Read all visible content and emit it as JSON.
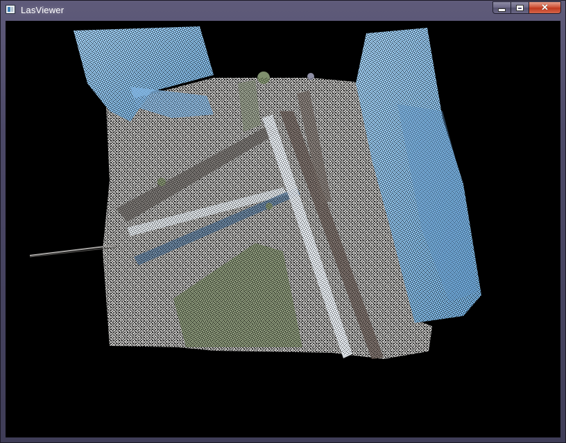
{
  "window": {
    "title": "LasViewer",
    "icon": "app-icon",
    "controls": {
      "minimize_icon": "minimize-icon",
      "maximize_icon": "maximize-icon",
      "close_icon": "close-icon",
      "close_glyph": "✕"
    }
  },
  "viewport": {
    "background": "#000000",
    "content": "point-cloud"
  }
}
